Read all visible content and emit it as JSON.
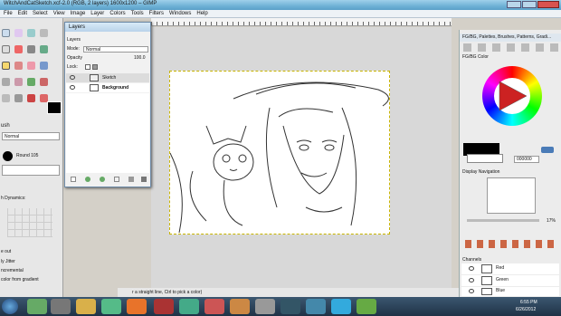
{
  "window": {
    "title": "WitchAndCatSketch.xcf-2.0 (RGB, 2 layers) 1600x1200 – GIMP"
  },
  "menu": [
    "File",
    "Edit",
    "Select",
    "View",
    "Image",
    "Layer",
    "Colors",
    "Tools",
    "Filters",
    "Windows",
    "Help"
  ],
  "toolbox": {
    "tool_options_title": "ush",
    "mode_value": "Normal",
    "brush_value": "Round 105",
    "dynamics_label": "h Dynamics:",
    "opt_fade": "e out",
    "opt_jitter": "ly Jitter",
    "opt_incremental": "ncremental",
    "opt_gradient": "color from gradient"
  },
  "layers": {
    "window_title": "Layers",
    "tab_label": "Layers",
    "mode_label": "Mode:",
    "mode_value": "Normal",
    "opacity_label": "Opacity",
    "opacity_value": "100.0",
    "lock_label": "Lock:",
    "items": [
      {
        "name": "Sketch"
      },
      {
        "name": "Background"
      }
    ]
  },
  "dock": {
    "header": "FG/BG, Palettes, Brushes, Patterns, Gradi...",
    "fgbg_tab": "FG/BG Color",
    "hex_value": "000000",
    "nav_title": "Display Navigation",
    "zoom_value": "17%",
    "channels_title": "Channels",
    "channels": [
      {
        "name": "Red"
      },
      {
        "name": "Green"
      },
      {
        "name": "Blue"
      }
    ]
  },
  "statusbar": {
    "hint": "r a straight line, Ctrl to pick a color)"
  },
  "taskbar": {
    "time": "6:55 PM",
    "date": "6/26/2012"
  },
  "colors": {
    "fg": "#000000",
    "bg": "#ffffff",
    "accent": "#5aa0c8"
  }
}
